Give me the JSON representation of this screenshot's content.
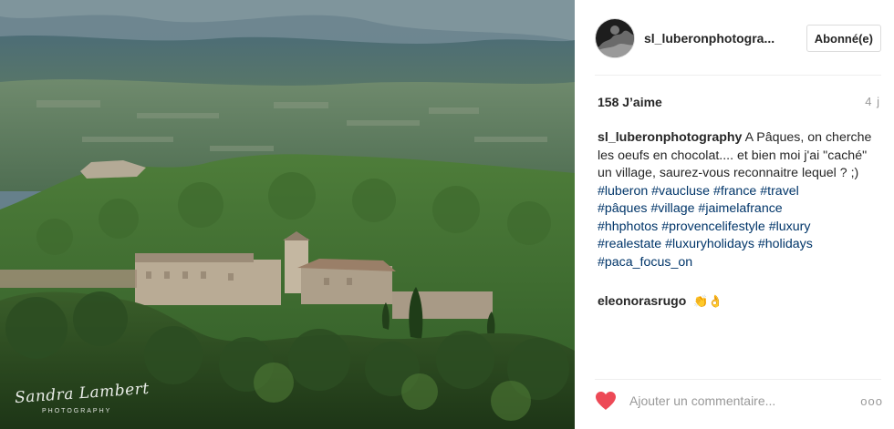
{
  "post": {
    "username": "sl_luberonphotogra...",
    "follow_label": "Abonné(e)",
    "likes": "158 J’aime",
    "timestamp": "4 j",
    "caption": {
      "username": "sl_luberonphotography",
      "text": "A Pâques, on cherche les oeufs en chocolat.... et bien moi j'ai \"caché\" un village, saurez-vous reconnaitre lequel ? ;)",
      "hashtags": [
        "#luberon #vaucluse #france #travel",
        "#pâques #village #jaimelafrance",
        "#hhphotos #provencelifestyle #luxury",
        "#realestate #luxuryholidays #holidays",
        "#paca_focus_on"
      ]
    },
    "comments": [
      {
        "username": "eleonorasrugo",
        "text": "👏👌"
      }
    ],
    "comment_placeholder": "Ajouter un commentaire...",
    "more_label": "ooo"
  },
  "photo": {
    "subject": "Provence hilltop village among green hills",
    "watermark_script": "Sandra Lambert",
    "watermark_caps": "PHOTOGRAPHY"
  },
  "colors": {
    "like_heart": "#ed4956",
    "hashtag": "#003569",
    "meta_gray": "#999999",
    "border": "#dbdbdb"
  },
  "icons": {
    "like": "heart-icon",
    "options": "more-options-icon"
  }
}
